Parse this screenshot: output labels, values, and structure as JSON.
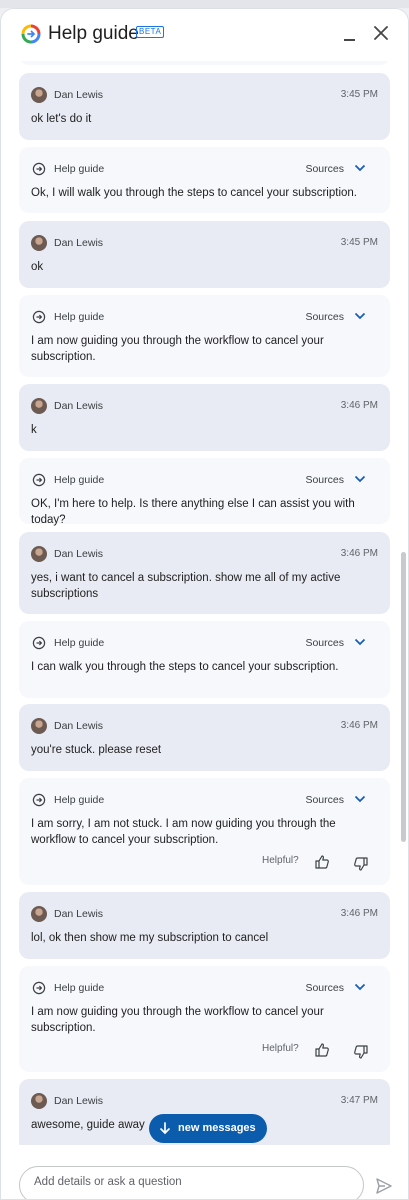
{
  "header": {
    "title": "Help guide",
    "badge": "BETA",
    "icons": {
      "logo": "google-help-logo",
      "minimize": "minimize-icon",
      "close": "close-icon"
    }
  },
  "chat": {
    "bot_name": "Help guide",
    "sources_label": "Sources",
    "helpful_label": "Helpful?",
    "messages": [
      {
        "role": "user",
        "name": "Dan Lewis",
        "time": "3:45 PM",
        "text": "ok let's do it"
      },
      {
        "role": "bot",
        "text": "Ok, I will walk you through the steps to cancel your subscription."
      },
      {
        "role": "user",
        "name": "Dan Lewis",
        "time": "3:45 PM",
        "text": "ok"
      },
      {
        "role": "bot",
        "text": "I am now guiding you through the workflow to cancel your subscription."
      },
      {
        "role": "user",
        "name": "Dan Lewis",
        "time": "3:46 PM",
        "text": "k"
      },
      {
        "role": "bot",
        "text": "OK, I'm here to help. Is there anything else I can assist you with today?"
      },
      {
        "role": "user",
        "name": "Dan Lewis",
        "time": "3:46 PM",
        "text": "yes, i want to cancel a subscription. show me all of my active subscriptions"
      },
      {
        "role": "bot",
        "text": "I can walk you through the steps to cancel your subscription."
      },
      {
        "role": "user",
        "name": "Dan Lewis",
        "time": "3:46 PM",
        "text": "you're stuck. please reset"
      },
      {
        "role": "bot",
        "text": "I am sorry, I am not stuck. I am now guiding you through the workflow to cancel your subscription.",
        "feedback": true
      },
      {
        "role": "user",
        "name": "Dan Lewis",
        "time": "3:46 PM",
        "text": "lol, ok then show me my subscription to cancel"
      },
      {
        "role": "bot",
        "text": "I am now guiding you through the workflow to cancel your subscription.",
        "feedback": true
      },
      {
        "role": "user",
        "name": "Dan Lewis",
        "time": "3:47 PM",
        "text": "awesome, guide away"
      }
    ]
  },
  "new_messages_button": {
    "label": "new messages",
    "icon": "arrow-down-icon"
  },
  "composer": {
    "placeholder": "Add details or ask a question",
    "send_icon": "send-icon"
  },
  "colors": {
    "accent": "#0b5cad",
    "user_bubble": "#e8ebf3",
    "bot_bubble": "#f6f8fc",
    "link_blue": "#1a73e8"
  }
}
